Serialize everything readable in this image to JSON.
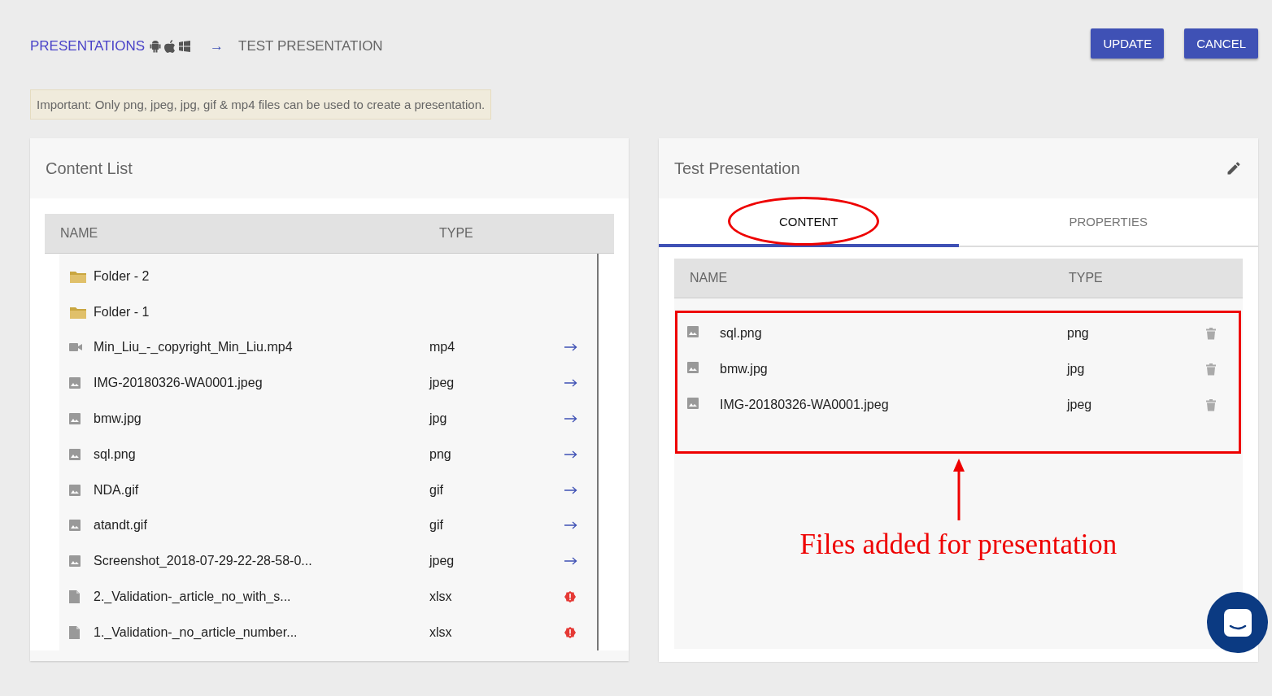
{
  "breadcrumb": {
    "root": "PRESENTATIONS",
    "separator": "→",
    "current": "TEST PRESENTATION"
  },
  "buttons": [
    "UPDATE",
    "CANCEL"
  ],
  "notice": "Important: Only png, jpeg, jpg, gif & mp4 files can be used to create a presentation.",
  "content_list": {
    "title": "Content List",
    "columns": [
      "NAME",
      "TYPE"
    ],
    "rows": [
      {
        "kind": "folder",
        "name": "Folder - 2"
      },
      {
        "kind": "folder",
        "name": "Folder - 1"
      },
      {
        "kind": "video",
        "name": "Min_Liu_-_copyright_Min_Liu.mp4",
        "type": "mp4",
        "invalid": false
      },
      {
        "kind": "image",
        "name": "IMG-20180326-WA0001.jpeg",
        "type": "jpeg",
        "invalid": false
      },
      {
        "kind": "image",
        "name": "bmw.jpg",
        "type": "jpg",
        "invalid": false
      },
      {
        "kind": "image",
        "name": "sql.png",
        "type": "png",
        "invalid": false
      },
      {
        "kind": "image",
        "name": "NDA.gif",
        "type": "gif",
        "invalid": false
      },
      {
        "kind": "image",
        "name": "atandt.gif",
        "type": "gif",
        "invalid": false
      },
      {
        "kind": "image",
        "name": "Screenshot_2018-07-29-22-28-58-0...",
        "type": "jpeg",
        "invalid": false
      },
      {
        "kind": "file",
        "name": "2._Validation-_article_no_with_s...",
        "type": "xlsx",
        "invalid": true
      },
      {
        "kind": "file",
        "name": "1._Validation-_no_article_number...",
        "type": "xlsx",
        "invalid": true
      }
    ]
  },
  "presentation": {
    "title": "Test Presentation",
    "tabs": [
      {
        "label": "CONTENT",
        "selected": true
      },
      {
        "label": "PROPERTIES",
        "selected": false
      }
    ],
    "columns": [
      "NAME",
      "TYPE"
    ],
    "rows": [
      {
        "kind": "image",
        "name": "sql.png",
        "type": "png"
      },
      {
        "kind": "image",
        "name": "bmw.jpg",
        "type": "jpg"
      },
      {
        "kind": "image",
        "name": "IMG-20180326-WA0001.jpeg",
        "type": "jpeg"
      }
    ],
    "annotation": "Files added for presentation"
  }
}
